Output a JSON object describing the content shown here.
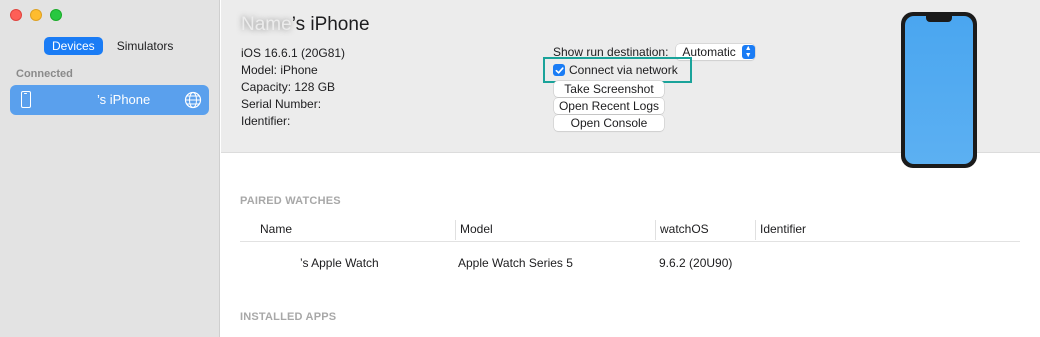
{
  "sidebar": {
    "tabs": [
      "Devices",
      "Simulators"
    ],
    "section": "Connected",
    "device_name": "’s iPhone"
  },
  "header": {
    "title": "’s iPhone",
    "info": {
      "ios": "iOS 16.6.1 (20G81)",
      "model": "Model: iPhone",
      "capacity": "Capacity: 128 GB",
      "serial": "Serial Number:",
      "identifier": "Identifier:"
    },
    "run_destination_label": "Show run destination:",
    "run_destination_value": "Automatic",
    "connect_network": "Connect via network",
    "connect_network_checked": true,
    "buttons": {
      "screenshot": "Take Screenshot",
      "logs": "Open Recent Logs",
      "console": "Open Console"
    }
  },
  "paired_watches": {
    "heading": "PAIRED WATCHES",
    "columns": [
      "Name",
      "Model",
      "watchOS",
      "Identifier"
    ],
    "rows": [
      {
        "name": "’s Apple Watch",
        "model": "Apple Watch Series 5",
        "watchos": "9.6.2 (20U90)",
        "identifier": ""
      }
    ]
  },
  "installed_apps": {
    "heading": "INSTALLED APPS"
  },
  "colors": {
    "accent": "#1a7cf5",
    "highlight": "#1aa39a",
    "selection": "#5aa0ed"
  }
}
